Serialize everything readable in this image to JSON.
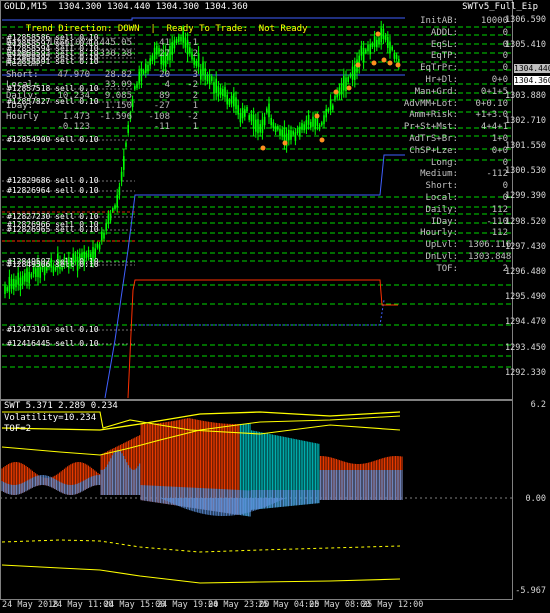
{
  "header": {
    "symbol_line": "GOLD,M15  1304.300 1304.440 1304.300 1304.360",
    "ea_name": "SWTv5_Full_Eip",
    "trend_label": "Trend Direction:",
    "trend_value": "DOWN",
    "separator": "|",
    "ready_label": "Ready To Trade:",
    "ready_value": "Not Ready"
  },
  "stats": {
    "columns": [
      "",
      "",
      "",
      "",
      ""
    ],
    "rows": [
      {
        "name": "Basic:",
        "v1": "1086.074",
        "v2": "445.05",
        "v3": "41",
        "v4": "-1"
      },
      {
        "name": "Long:",
        "v1": "",
        "v2": "330.38",
        "v3": "27",
        "v4": "2"
      },
      {
        "name": "Medium:",
        "v1": "",
        "v2": "",
        "v3": "",
        "v4": ""
      },
      {
        "name": "Short:",
        "v1": "47.970",
        "v2": "28.82",
        "v3": "20",
        "v4": "3"
      },
      {
        "name": "Local:",
        "v1": "",
        "v2": "33.09",
        "v3": "4",
        "v4": "-2"
      },
      {
        "name": "Daily:",
        "v1": "10.234",
        "v2": "9.085",
        "v3": "89",
        "v4": "2"
      },
      {
        "name": "IDay:",
        "v1": "",
        "v2": "1.150",
        "v3": "-27",
        "v4": "1"
      },
      {
        "name": "Hourly",
        "v1": "1.473",
        "v2": "-1.596",
        "v3": "-108",
        "v4": "-2"
      },
      {
        "name": "",
        "v1": "-0.123",
        "v2": "",
        "v3": "-11",
        "v4": "1"
      }
    ]
  },
  "right_panel": [
    {
      "k": "InitAB:",
      "v": "10000"
    },
    {
      "k": "ADDL:",
      "v": "0"
    },
    {
      "k": "EqSL:",
      "v": "0"
    },
    {
      "k": "EqTP:",
      "v": "0"
    },
    {
      "k": "EqTrPr:",
      "v": "0"
    },
    {
      "k": "Hr+Dl:",
      "v": "0+0"
    },
    {
      "k": "Man+Grd:",
      "v": "0+1+5"
    },
    {
      "k": "AdvMM+Lot:",
      "v": "0+0.10"
    },
    {
      "k": "Amm+Risk:",
      "v": "+1+3.0"
    },
    {
      "k": "Pr+St+Mst:",
      "v": "4+4+1"
    },
    {
      "k": "AdTrS+Br:",
      "v": "1+0"
    },
    {
      "k": "ChSP+Lze:",
      "v": "0+0"
    },
    {
      "k": "Long:",
      "v": "0"
    },
    {
      "k": "Medium:",
      "v": "-112"
    },
    {
      "k": "Short:",
      "v": "0"
    },
    {
      "k": "Local:",
      "v": "0"
    },
    {
      "k": "Daily:",
      "v": "112"
    },
    {
      "k": "IDay:",
      "v": "-110"
    },
    {
      "k": "Hourly:",
      "v": "112"
    },
    {
      "k": "UpLvl:",
      "v": "1306.116"
    },
    {
      "k": "DnLvl:",
      "v": "1303.848"
    },
    {
      "k": "TOF:",
      "v": "2"
    }
  ],
  "orders": [
    "#12858586 sell 0.10",
    "#12858597 sell 0.10",
    "#12858594 sell 0.10",
    "#12858593 sell 0.10",
    "#12858592 sell 0.10",
    "#12858591 sell 0.10",
    "#12857518 sell 0.10",
    "#12857827 sell 0.10",
    "#12854900 sell 0.10",
    "#12829686 sell 0.10",
    "#12826964 sell 0.10",
    "#12827230 sell 0.10",
    "#12826966 sell 0.10",
    "#12826965 sell 0.10",
    "#12849507 sell 0.10",
    "#12849506 sell 0.10",
    "#12473101 sell 0.10",
    "#12416445 sell 0.10"
  ],
  "price_axis": [
    "1306.590",
    "1305.410",
    "1304.360",
    "1303.880",
    "1302.710",
    "1301.550",
    "1300.530",
    "1299.390",
    "1298.520",
    "1297.430",
    "1296.480",
    "1295.490",
    "1294.470",
    "1293.450",
    "1292.330"
  ],
  "price_tags": {
    "bid": "1304.360",
    "ask": "1304.440"
  },
  "indicator": {
    "title": "SWT 5.371 2.289 0.234",
    "volatility": "Volatility=10.234",
    "tof": "TOF=2",
    "axis": [
      "6.2",
      "0.00",
      "-5.967"
    ]
  },
  "time_axis": [
    "24 May 2018",
    "24 May 11:00",
    "24 May 15:00",
    "24 May 19:00",
    "24 May 23:00",
    "25 May 04:00",
    "25 May 08:00",
    "25 May 12:00"
  ],
  "colors": {
    "trend": "#ffff00",
    "ready": "#ffff00",
    "candle_up": "#00ff00",
    "candle_down": "#00ff00",
    "level_green": "#00ff00",
    "blue_line": "#4060ff",
    "red_line": "#ff3000",
    "indicator_blue": "#5b8fd8",
    "indicator_red": "#ff4000",
    "indicator_yellow": "#ffff00",
    "indicator_cyan": "#00c0c0"
  }
}
